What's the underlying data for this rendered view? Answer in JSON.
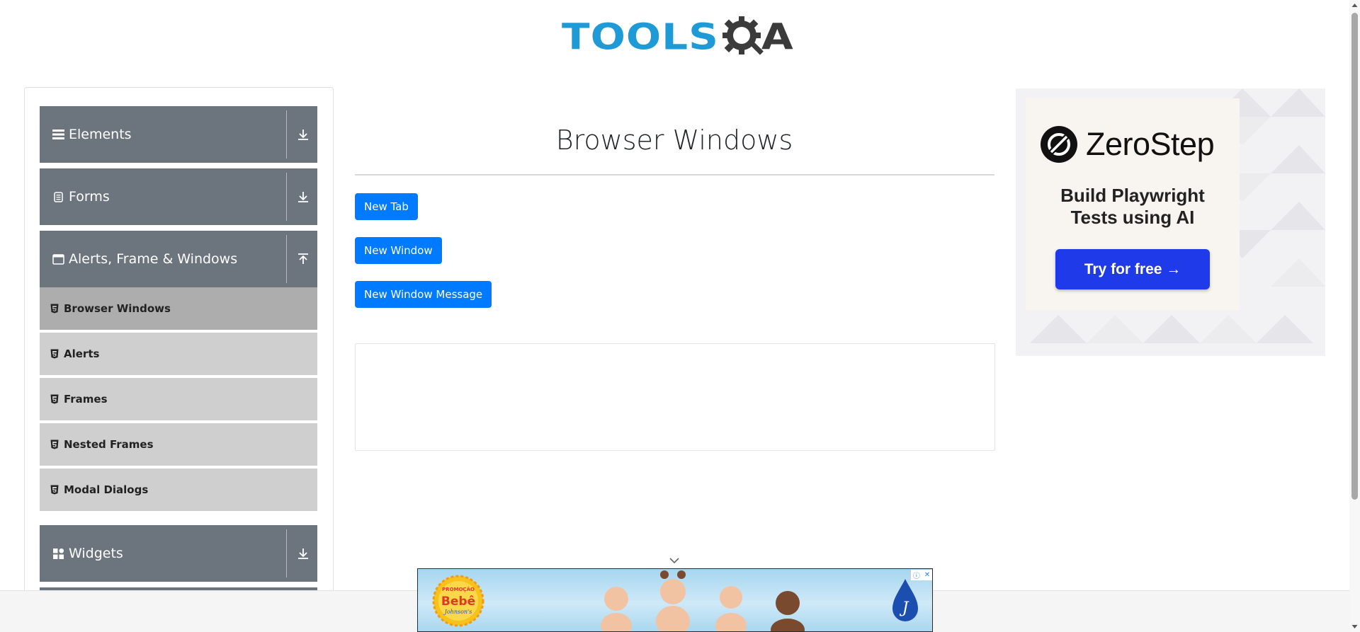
{
  "header": {
    "logo_text_tools": "TOOLS",
    "logo_text_a": "A",
    "logo_primary_color": "#1e9bd7",
    "logo_secondary_color": "#3b3b3b"
  },
  "sidebar": {
    "groups": [
      {
        "label": "Elements",
        "icon": "list-icon",
        "state": "collapsed"
      },
      {
        "label": "Forms",
        "icon": "form-icon",
        "state": "collapsed"
      },
      {
        "label": "Alerts, Frame & Windows",
        "icon": "window-icon",
        "state": "expanded"
      },
      {
        "label": "Widgets",
        "icon": "widgets-icon",
        "state": "collapsed"
      }
    ],
    "items": [
      {
        "label": "Browser Windows",
        "active": true
      },
      {
        "label": "Alerts",
        "active": false
      },
      {
        "label": "Frames",
        "active": false
      },
      {
        "label": "Nested Frames",
        "active": false
      },
      {
        "label": "Modal Dialogs",
        "active": false
      }
    ],
    "header_color": "#6c757d",
    "item_color": "#cfcfcf",
    "active_item_color": "#adadad"
  },
  "main": {
    "title": "Browser Windows",
    "buttons": {
      "new_tab": "New Tab",
      "new_window": "New Window",
      "new_window_message": "New Window Message"
    },
    "button_color": "#007bff"
  },
  "right_ad": {
    "brand": "ZeroStep",
    "tagline_line1": "Build Playwright",
    "tagline_line2": "Tests using AI",
    "cta": "Try for free →",
    "cta_color": "#1f3ae8"
  },
  "bottom_ad": {
    "badge_top": "PROMOÇÃO",
    "badge_main": "Bebê",
    "badge_brand": "Johnson's",
    "adchoices_icon": "info-icon",
    "close_icon": "close-icon"
  }
}
